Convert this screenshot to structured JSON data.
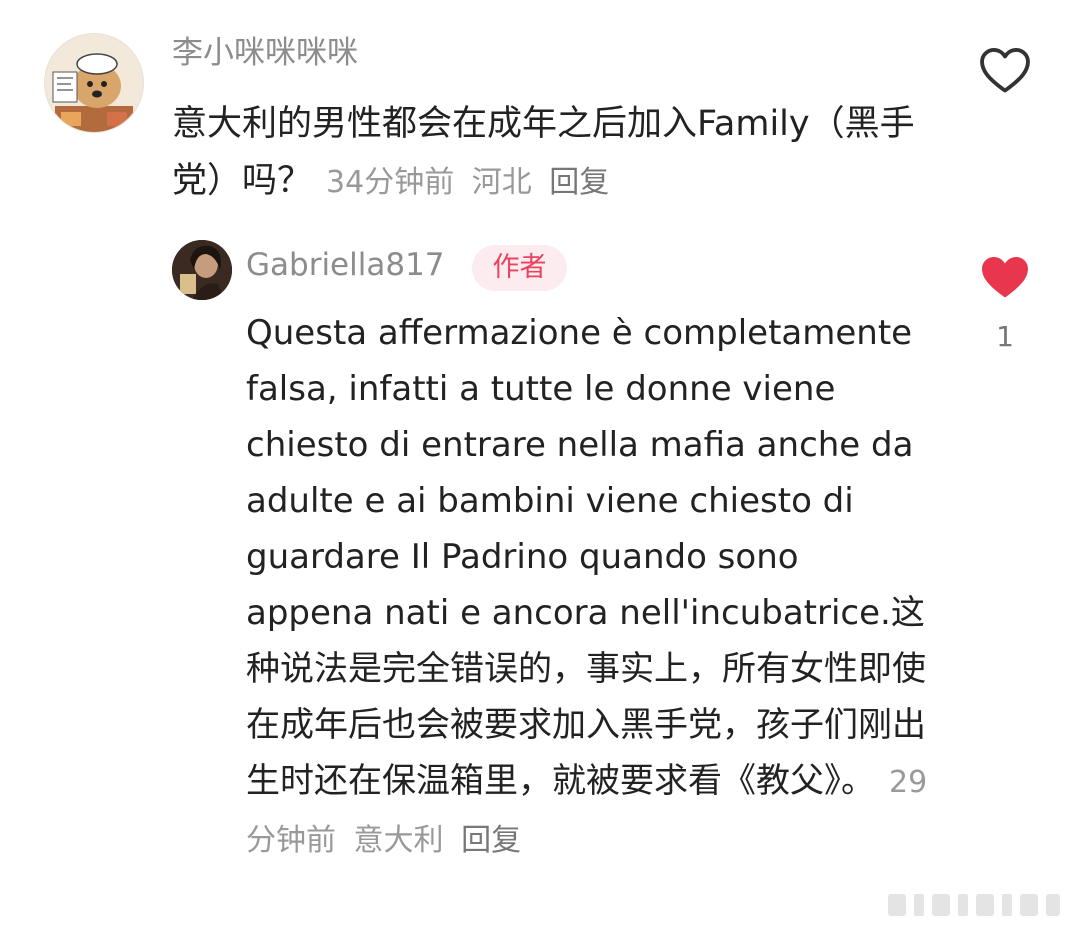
{
  "comment": {
    "username": "李小咪咪咪咪",
    "text": "意大利的男性都会在成年之后加入Family（黑手党）吗？",
    "time": "34分钟前",
    "location": "河北",
    "reply_label": "回复",
    "like_icon": "heart-outline-icon"
  },
  "reply": {
    "username": "Gabriella817",
    "badge": "作者",
    "text": "Questa affermazione  è completamente falsa, infatti a tutte le donne viene chiesto di entrare nella mafia anche da adulte e ai bambini viene chiesto di guardare Il Padrino quando sono appena nati e ancora nell'incubatrice.这种说法是完全错误的，事实上，所有女性即使在成年后也会被要求加入黑手党，孩子们刚出生时还在保温箱里，就被要求看《教父》。",
    "time": "29分钟前",
    "location": "意大利",
    "reply_label": "回复",
    "like_icon": "heart-filled-icon",
    "like_count": "1"
  },
  "colors": {
    "liked": "#e8364f",
    "badge_bg": "#fdecef",
    "badge_text": "#e8435f"
  }
}
